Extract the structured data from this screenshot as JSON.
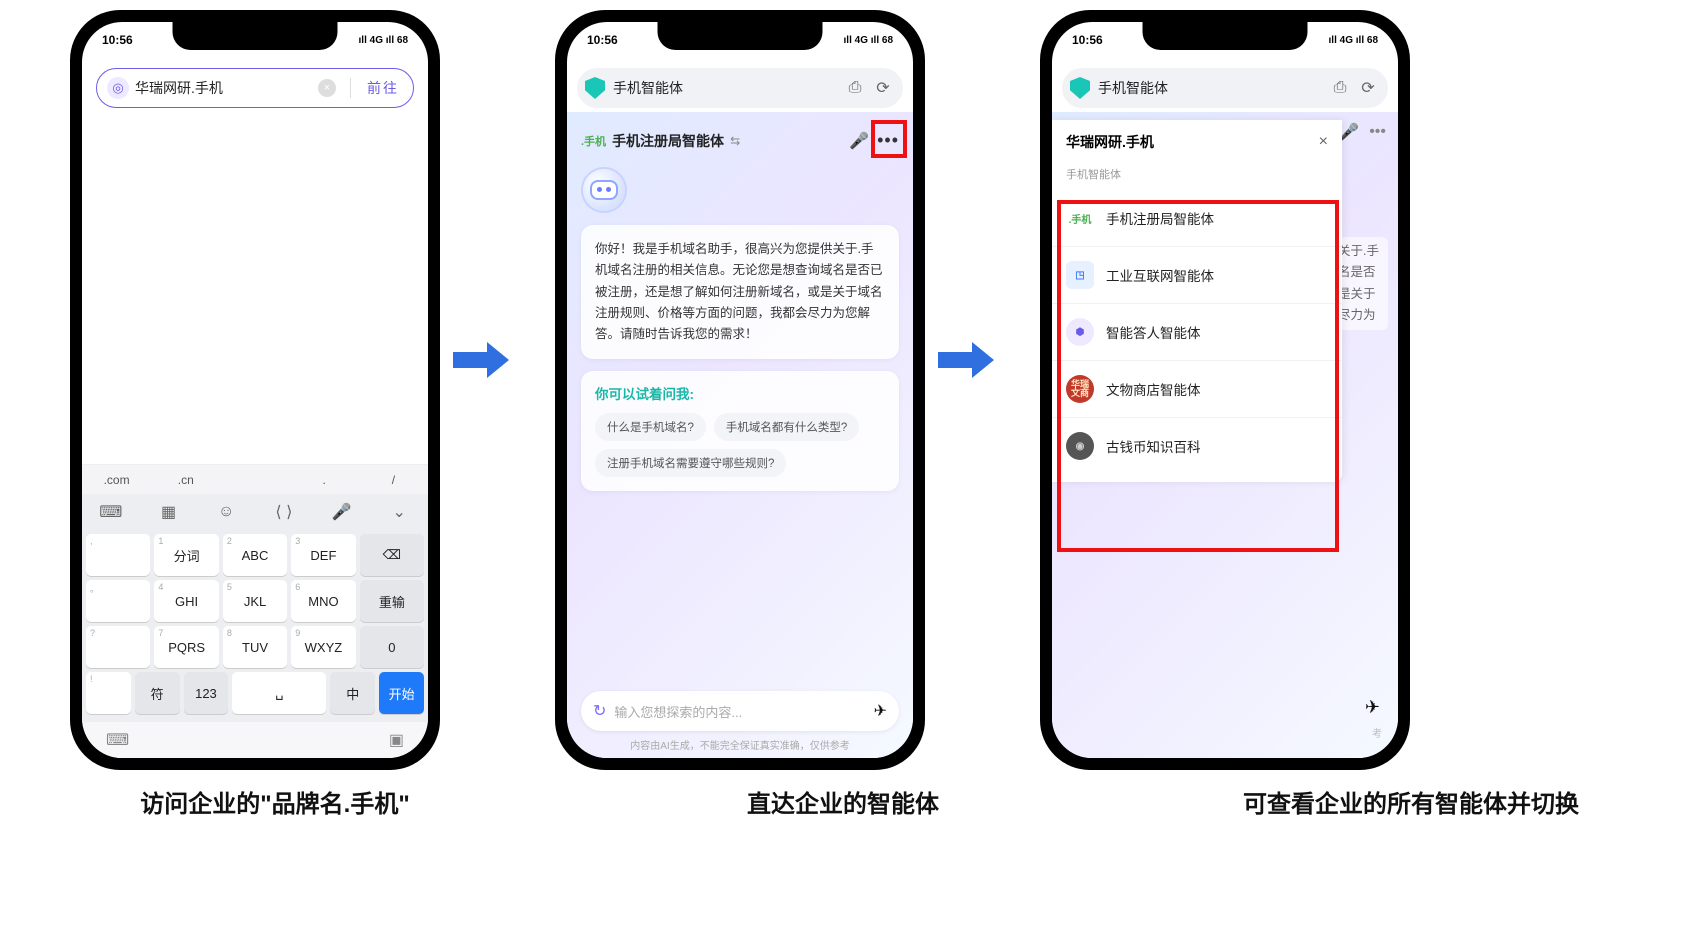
{
  "status": {
    "time": "10:56",
    "indicators": "ıll 4G ıll 68"
  },
  "phone1": {
    "address_text": "华瑞网研.手机",
    "go_label": "前往",
    "tlds": [
      ".com",
      ".cn",
      "",
      ".",
      "/"
    ],
    "toolrow": [
      "⌨",
      "▦",
      "☺",
      "⟨ ⟩",
      "🎤",
      "⌄"
    ],
    "rows": [
      [
        {
          "sub": ",",
          "main": ""
        },
        {
          "sub": "1",
          "main": "分词"
        },
        {
          "sub": "2",
          "main": "ABC"
        },
        {
          "sub": "3",
          "main": "DEF"
        },
        {
          "sub": "",
          "main": "⌫",
          "func": true
        }
      ],
      [
        {
          "sub": "。",
          "main": ""
        },
        {
          "sub": "4",
          "main": "GHI"
        },
        {
          "sub": "5",
          "main": "JKL"
        },
        {
          "sub": "6",
          "main": "MNO"
        },
        {
          "sub": "",
          "main": "重输",
          "func": true
        }
      ],
      [
        {
          "sub": "?",
          "main": ""
        },
        {
          "sub": "7",
          "main": "PQRS"
        },
        {
          "sub": "8",
          "main": "TUV"
        },
        {
          "sub": "9",
          "main": "WXYZ"
        },
        {
          "sub": "",
          "main": "0",
          "func": true
        }
      ],
      [
        {
          "sub": "!",
          "main": ""
        },
        {
          "sub": "",
          "main": "符",
          "func": true
        },
        {
          "sub": "",
          "main": "123",
          "func": true
        },
        {
          "sub": "",
          "main": "␣",
          "space": true
        },
        {
          "sub": "",
          "main": "中",
          "func": true
        },
        {
          "sub": "",
          "main": "开始",
          "primary": true
        }
      ]
    ]
  },
  "phone2": {
    "search_text": "手机智能体",
    "agent_logo": ".手机",
    "agent_name": "手机注册局智能体",
    "greeting": "你好！我是手机域名助手，很高兴为您提供关于.手机域名注册的相关信息。无论您是想查询域名是否已被注册，还是想了解如何注册新域名，或是关于域名注册规则、价格等方面的问题，我都会尽力为您解答。请随时告诉我您的需求！",
    "suggest_title": "你可以试着问我:",
    "chips": [
      "什么是手机域名?",
      "手机域名都有什么类型?",
      "注册手机域名需要遵守哪些规则?"
    ],
    "input_placeholder": "输入您想探索的内容...",
    "disclaimer": "内容由AI生成，不能完全保证真实准确，仅供参考"
  },
  "phone3": {
    "search_text": "手机智能体",
    "panel_title": "华瑞网研.手机",
    "panel_sub": "手机智能体",
    "agents": [
      {
        "icon": "shouji",
        "label": "手机注册局智能体"
      },
      {
        "icon": "cube",
        "label": "工业互联网智能体"
      },
      {
        "icon": "hex",
        "label": "智能答人智能体"
      },
      {
        "icon": "redcircle",
        "label": "文物商店智能体"
      },
      {
        "icon": "coin",
        "label": "古钱币知识百科"
      }
    ],
    "hints": [
      "关于.手",
      "名是否",
      "是关于",
      "尽力为"
    ],
    "bottom_hint": "考"
  },
  "captions": {
    "c1": "访问企业的\"品牌名.手机\"",
    "c2": "直达企业的智能体",
    "c3": "可查看企业的所有智能体并切换"
  }
}
